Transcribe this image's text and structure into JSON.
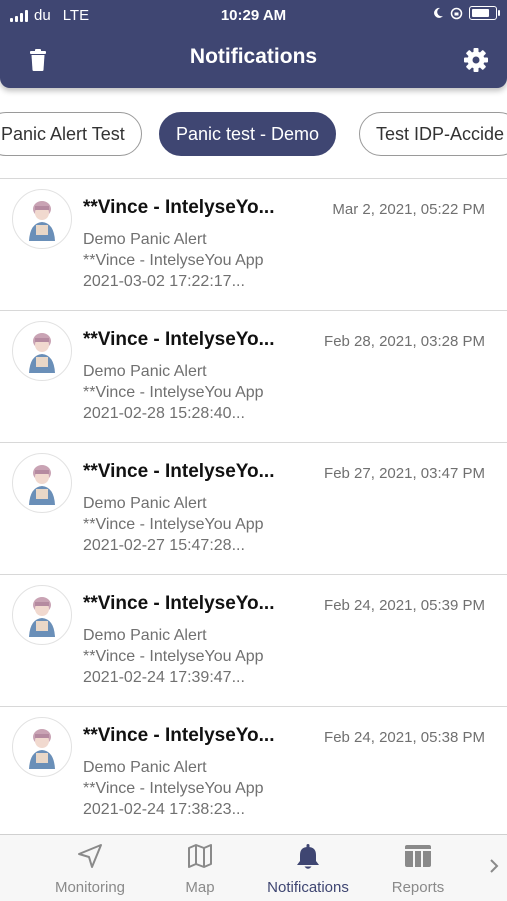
{
  "status_bar": {
    "carrier": "du",
    "network": "LTE",
    "time": "10:29 AM",
    "battery_level": 0.75
  },
  "header": {
    "title": "Notifications",
    "left_icon": "trash-icon",
    "right_icon": "gear-icon",
    "color": "#3f4672"
  },
  "filters": [
    {
      "label": "Panic Alert Test",
      "active": false
    },
    {
      "label": "Panic test - Demo",
      "active": true
    },
    {
      "label": "Test IDP-Accide",
      "active": false
    }
  ],
  "notifications": [
    {
      "sender": "**Vince - IntelyseYo...",
      "date": "Mar 2, 2021, 05:22 PM",
      "line1": "Demo Panic Alert",
      "line2": "**Vince - IntelyseYou App",
      "line3": "2021-03-02 17:22:17..."
    },
    {
      "sender": "**Vince - IntelyseYo...",
      "date": "Feb 28, 2021, 03:28 PM",
      "line1": "Demo Panic Alert",
      "line2": "**Vince - IntelyseYou App",
      "line3": "2021-02-28 15:28:40..."
    },
    {
      "sender": "**Vince - IntelyseYo...",
      "date": "Feb 27, 2021, 03:47 PM",
      "line1": "Demo Panic Alert",
      "line2": "**Vince - IntelyseYou App",
      "line3": "2021-02-27 15:47:28..."
    },
    {
      "sender": "**Vince - IntelyseYo...",
      "date": "Feb 24, 2021, 05:39 PM",
      "line1": "Demo Panic Alert",
      "line2": "**Vince - IntelyseYou App",
      "line3": "2021-02-24 17:39:47..."
    },
    {
      "sender": "**Vince - IntelyseYo...",
      "date": "Feb 24, 2021, 05:38 PM",
      "line1": "Demo Panic Alert",
      "line2": "**Vince - IntelyseYou App",
      "line3": "2021-02-24 17:38:23..."
    }
  ],
  "tabbar": {
    "tabs": [
      {
        "label": "Monitoring",
        "icon": "navigation-arrow-icon",
        "active": false
      },
      {
        "label": "Map",
        "icon": "map-icon",
        "active": false
      },
      {
        "label": "Notifications",
        "icon": "bell-icon",
        "active": true
      },
      {
        "label": "Reports",
        "icon": "reports-table-icon",
        "active": false
      }
    ],
    "more_icon": "chevron-right-icon",
    "active_color": "#3f4672",
    "inactive_color": "#8a8a8a"
  }
}
